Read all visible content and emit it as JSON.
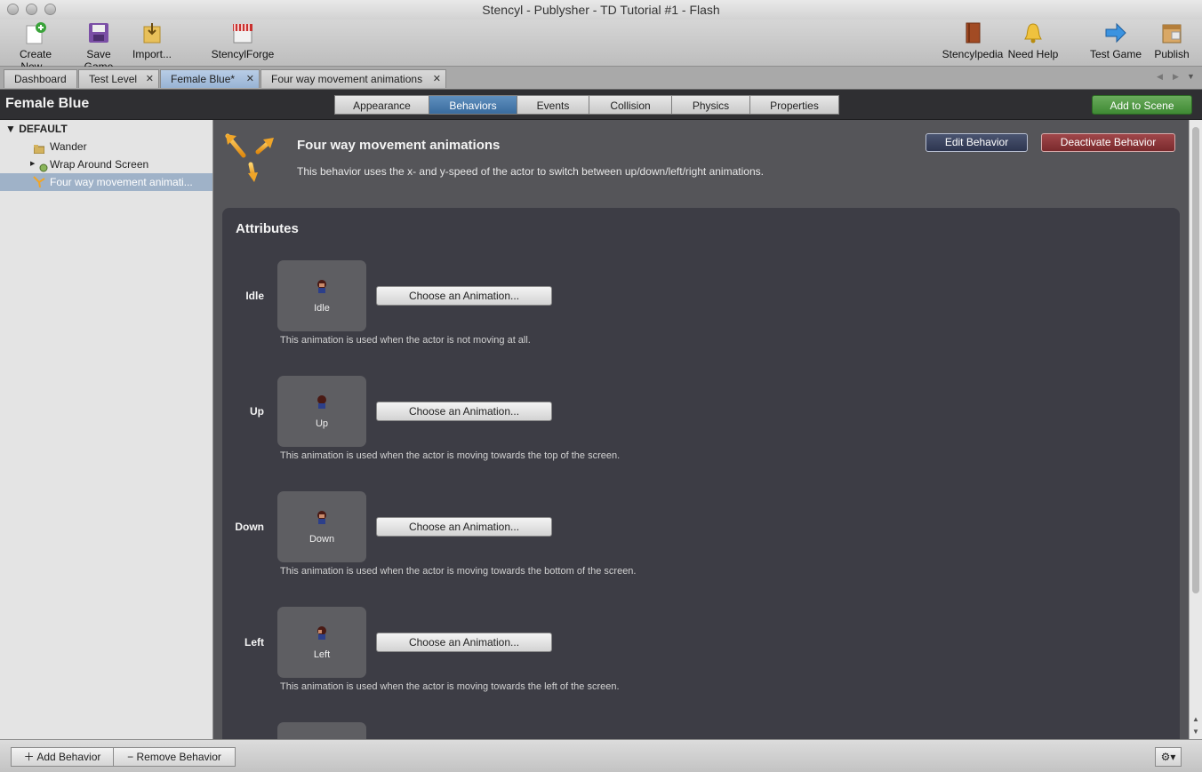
{
  "window": {
    "title": "Stencyl - Publysher - TD Tutorial #1 - Flash"
  },
  "toolbar": {
    "create_new": "Create New...",
    "save_game": "Save Game",
    "import": "Import...",
    "stencylforge": "StencylForge",
    "stencylpedia": "Stencylpedia",
    "need_help": "Need Help",
    "test_game": "Test Game",
    "publish": "Publish"
  },
  "tabs": [
    {
      "label": "Dashboard"
    },
    {
      "label": "Test Level"
    },
    {
      "label": "Female Blue*"
    },
    {
      "label": "Four way movement animations"
    }
  ],
  "header": {
    "actor_name": "Female Blue",
    "segments": [
      "Appearance",
      "Behaviors",
      "Events",
      "Collision",
      "Physics",
      "Properties"
    ],
    "active_segment": "Behaviors",
    "add_to_scene": "Add to Scene"
  },
  "sidebar": {
    "group": "DEFAULT",
    "items": [
      {
        "label": "Wander"
      },
      {
        "label": "Wrap Around Screen"
      },
      {
        "label": "Four way movement animati..."
      }
    ]
  },
  "behavior": {
    "title": "Four way movement animations",
    "description": "This behavior uses the x- and y-speed of the actor to switch between up/down/left/right animations.",
    "edit_button": "Edit Behavior",
    "deactivate_button": "Deactivate Behavior"
  },
  "attributes": {
    "heading": "Attributes",
    "choose_label": "Choose an Animation...",
    "items": [
      {
        "label": "Idle",
        "anim": "Idle",
        "hint": "This animation is used when the actor is not moving at all."
      },
      {
        "label": "Up",
        "anim": "Up",
        "hint": "This animation is used when the actor is moving towards the top of the screen."
      },
      {
        "label": "Down",
        "anim": "Down",
        "hint": "This animation is used when the actor is moving towards the bottom of the screen."
      },
      {
        "label": "Left",
        "anim": "Left",
        "hint": "This animation is used when the actor is moving towards the left of the screen."
      }
    ]
  },
  "bottom": {
    "add_behavior": "Add Behavior",
    "remove_behavior": "Remove Behavior"
  },
  "colors": {
    "active_segment": "#3a6c9e",
    "add_to_scene": "#3f8a34",
    "deactivate": "#7a2a2d",
    "edit": "#2e3650"
  },
  "icons": [
    "create-new-icon",
    "save-icon",
    "import-icon",
    "stencylforge-icon",
    "stencylpedia-icon",
    "need-help-bell-icon",
    "test-game-arrow-icon",
    "publish-icon",
    "behavior-arrows-icon",
    "gear-icon"
  ]
}
